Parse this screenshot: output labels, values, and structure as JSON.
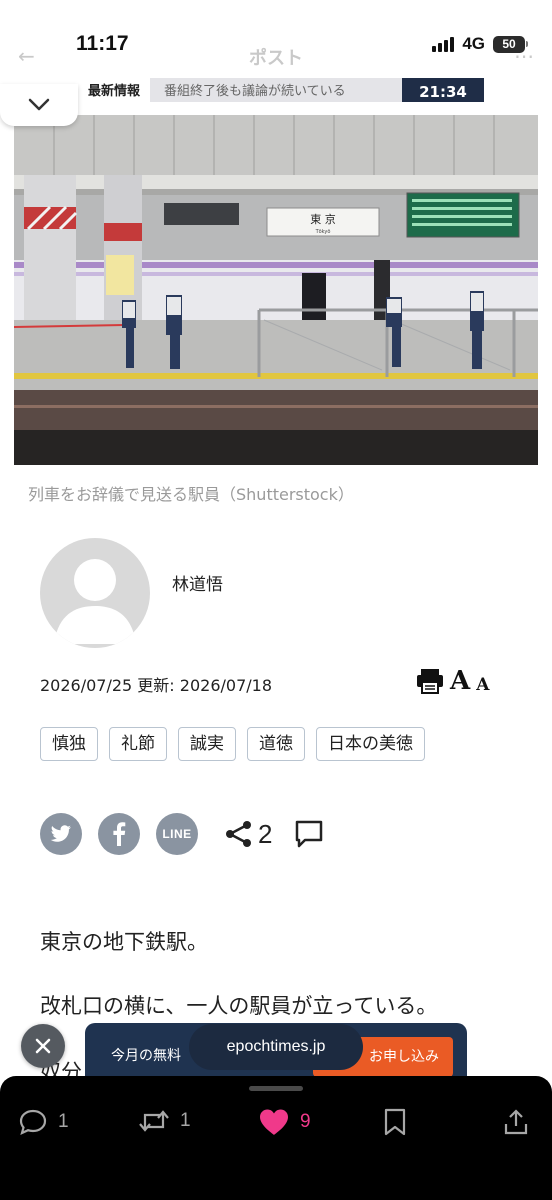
{
  "status": {
    "time": "11:17",
    "network": "4G",
    "battery": "50"
  },
  "nav": {
    "title": "ポスト",
    "back_icon": "arrow-left-icon",
    "more_icon": "more-icon"
  },
  "video_strip": {
    "label": "最新情報",
    "text": "番組終了後も議論が続いている",
    "time": "21:34"
  },
  "article": {
    "image_caption": "列車をお辞儀で見送る駅員（Shutterstock）",
    "author": "林道悟",
    "date_line": "2026/07/25 更新: 2026/07/18",
    "tags": [
      "慎独",
      "礼節",
      "誠実",
      "道徳",
      "日本の美徳"
    ],
    "share": {
      "count": "2"
    },
    "paragraphs": [
      "東京の地下鉄駅。",
      "改札口の横に、一人の駅員が立っている。",
      "奴分"
    ]
  },
  "photo": {
    "station_sign": "東 京",
    "station_sign_roman": "Tōkyō"
  },
  "promo": {
    "text": "今月の無料",
    "url": "epochtimes.jp",
    "button": "お申し込み"
  },
  "actions": {
    "replies": "1",
    "reposts": "1",
    "likes": "9"
  },
  "colors": {
    "accent_like": "#f0398a",
    "promo_bg": "#1f3350",
    "promo_button": "#ea5b25",
    "share_icon_bg": "#8a94a1"
  }
}
